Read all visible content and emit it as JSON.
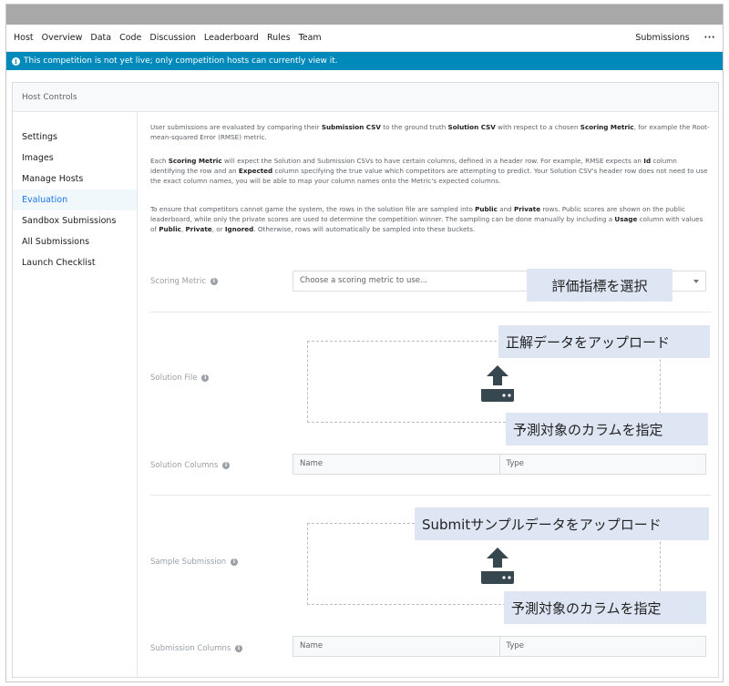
{
  "nav": {
    "tabs": [
      "Host",
      "Overview",
      "Data",
      "Code",
      "Discussion",
      "Leaderboard",
      "Rules",
      "Team"
    ],
    "active_tab": "Host",
    "submissions_label": "Submissions",
    "more_label": "···"
  },
  "banner": {
    "icon": "info-icon",
    "text": "This competition is not yet live; only competition hosts can currently view it."
  },
  "panel": {
    "title": "Host Controls"
  },
  "sidebar": {
    "items": [
      {
        "label": "Settings"
      },
      {
        "label": "Images"
      },
      {
        "label": "Manage Hosts"
      },
      {
        "label": "Evaluation",
        "active": true
      },
      {
        "label": "Sandbox Submissions"
      },
      {
        "label": "All Submissions"
      },
      {
        "label": "Launch Checklist"
      }
    ]
  },
  "description": {
    "p1": [
      {
        "t": "User submissions are evaluated by comparing their "
      },
      {
        "t": "Submission CSV",
        "b": true
      },
      {
        "t": " to the ground truth "
      },
      {
        "t": "Solution CSV",
        "b": true
      },
      {
        "t": " with respect to a chosen "
      },
      {
        "t": "Scoring Metric",
        "b": true
      },
      {
        "t": ", for example the Root-mean-squared Error (RMSE) metric."
      }
    ],
    "p2": [
      {
        "t": "Each "
      },
      {
        "t": "Scoring Metric",
        "b": true
      },
      {
        "t": " will expect the Solution and Submission CSVs to have certain columns, defined in a header row. For example, RMSE expects an "
      },
      {
        "t": "Id",
        "b": true
      },
      {
        "t": " column identifying the row and an "
      },
      {
        "t": "Expected",
        "b": true
      },
      {
        "t": " column specifying the true value which competitors are attempting to predict. Your Solution CSV's header row does not need to use the exact column names, you will be able to map your column names onto the Metric's expected columns."
      }
    ],
    "p3": [
      {
        "t": "To ensure that competitors cannot game the system, the rows in the solution file are sampled into "
      },
      {
        "t": "Public",
        "b": true
      },
      {
        "t": " and "
      },
      {
        "t": "Private",
        "b": true
      },
      {
        "t": " rows. Public scores are shown on the public leaderboard, while only the private scores are used to determine the competition winner. The sampling can be done manually by including a "
      },
      {
        "t": "Usage",
        "b": true
      },
      {
        "t": " column with values of "
      },
      {
        "t": "Public",
        "b": true
      },
      {
        "t": ", "
      },
      {
        "t": "Private",
        "b": true
      },
      {
        "t": ", or "
      },
      {
        "t": "Ignored",
        "b": true
      },
      {
        "t": ". Otherwise, rows will automatically be sampled into these buckets."
      }
    ]
  },
  "form": {
    "scoring_metric_label": "Scoring Metric",
    "scoring_metric_placeholder": "Choose a scoring metric to use...",
    "solution_file_label": "Solution File",
    "solution_columns_label": "Solution Columns",
    "sample_submission_label": "Sample Submission",
    "submission_columns_label": "Submission Columns",
    "col_name": "Name",
    "col_type": "Type",
    "upload_icon": "upload-icon"
  },
  "annotations": {
    "select_metric": "評価指標を選択",
    "upload_solution": "正解データをアップロード",
    "specify_columns_1": "予測対象のカラムを指定",
    "upload_sample": "Submitサンプルデータをアップロード",
    "specify_columns_2": "予測対象のカラムを指定"
  },
  "colors": {
    "accent": "#1a73e8",
    "banner": "#008abc",
    "annotation_bg": "#dde6f2"
  }
}
